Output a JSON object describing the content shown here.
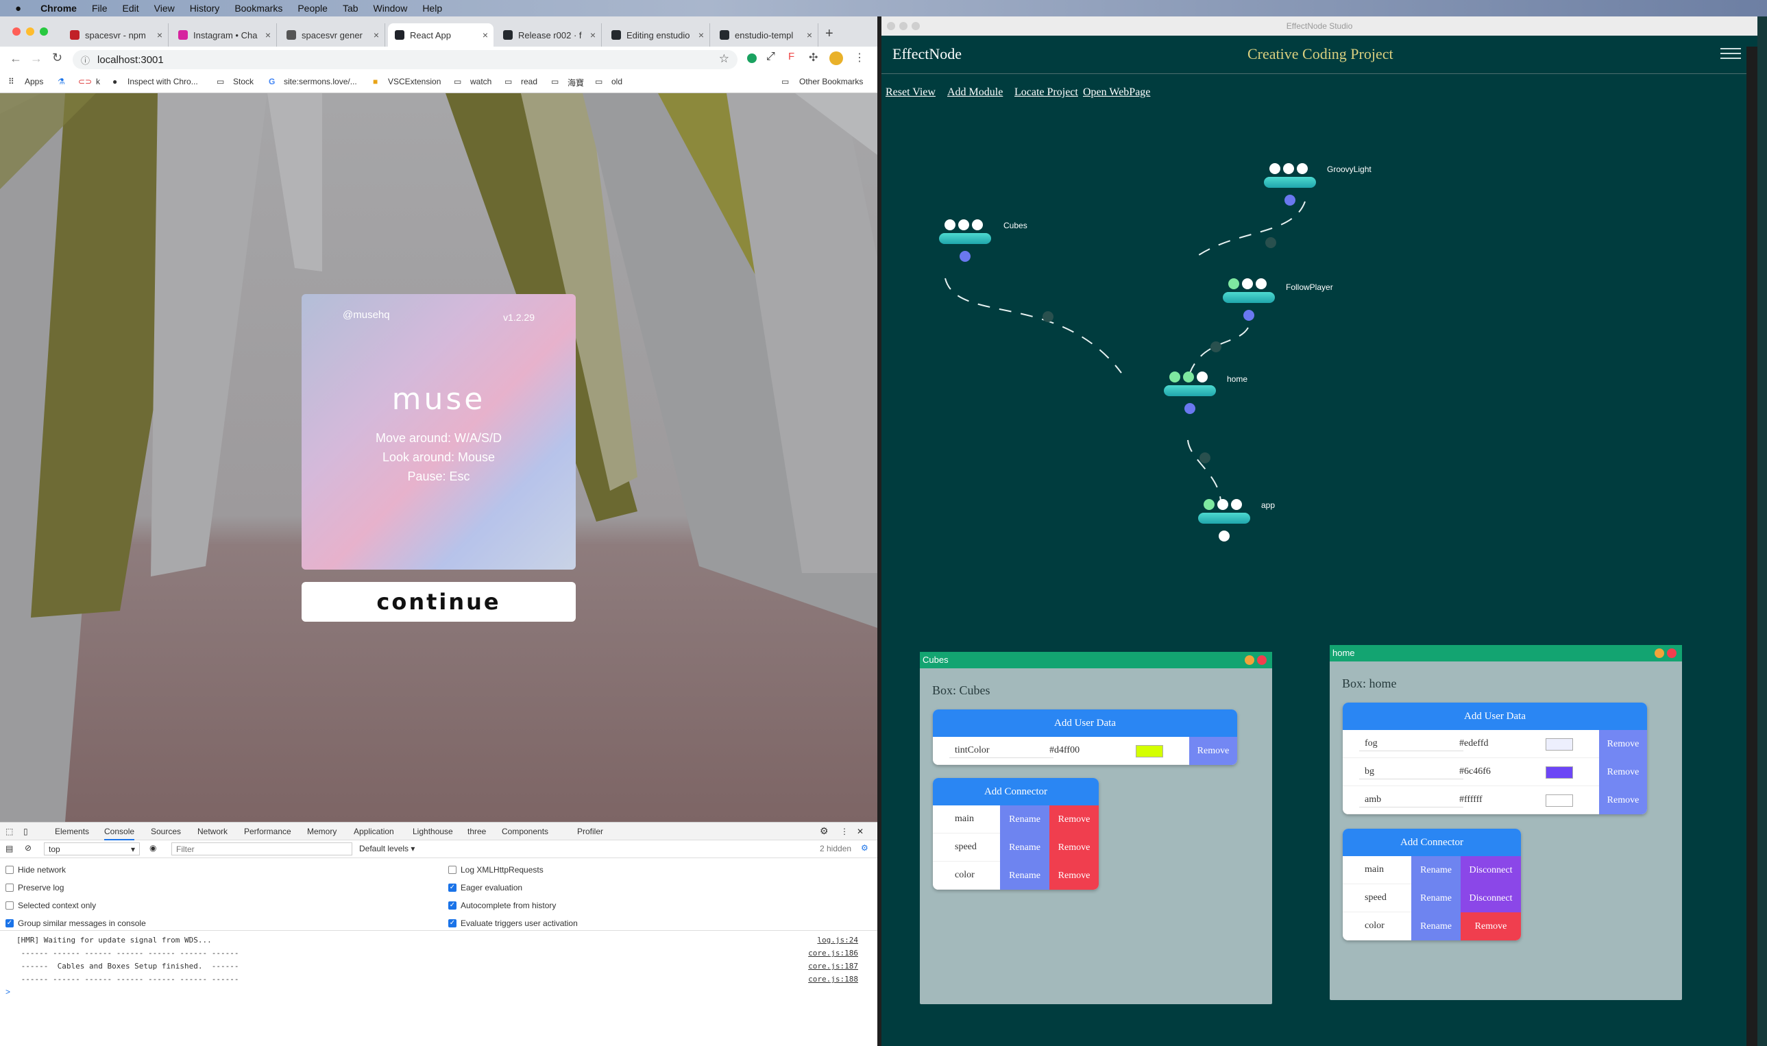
{
  "menubar": {
    "app": "Chrome",
    "items": [
      "File",
      "Edit",
      "View",
      "History",
      "Bookmarks",
      "People",
      "Tab",
      "Window",
      "Help"
    ]
  },
  "browser": {
    "tabs": [
      {
        "label": "spacesvr - npm",
        "color": "#c12127"
      },
      {
        "label": "Instagram • Cha",
        "color": "#d6249f"
      },
      {
        "label": "spacesvr gener",
        "color": "#555555"
      },
      {
        "label": "React App",
        "color": "#20232a"
      },
      {
        "label": "Release r002 · f",
        "color": "#24292e"
      },
      {
        "label": "Editing enstudio",
        "color": "#24292e"
      },
      {
        "label": "enstudio-templ",
        "color": "#24292e"
      }
    ],
    "new_tab": "+",
    "url": "localhost:3001",
    "bookmarks": [
      "Apps",
      "k",
      "Inspect with Chro...",
      "Stock",
      "site:sermons.love/...",
      "VSCExtension",
      "watch",
      "read",
      "海寶",
      "old",
      "Other Bookmarks"
    ]
  },
  "muse": {
    "handle": "@musehq",
    "version": "v1.2.29",
    "title": "muse",
    "line1": "Move around: W/A/S/D",
    "line2": "Look around: Mouse",
    "line3": "Pause: Esc",
    "continue": "continue"
  },
  "devtools": {
    "tabs": [
      "Elements",
      "Console",
      "Sources",
      "Network",
      "Performance",
      "Memory",
      "Application",
      "Lighthouse",
      "three",
      "Components",
      "Profiler"
    ],
    "context": "top",
    "filter_placeholder": "Filter",
    "levels": "Default levels ▾",
    "hidden": "2 hidden",
    "options_left": [
      {
        "label": "Hide network",
        "on": false
      },
      {
        "label": "Preserve log",
        "on": false
      },
      {
        "label": "Selected context only",
        "on": false
      },
      {
        "label": "Group similar messages in console",
        "on": true
      }
    ],
    "options_right": [
      {
        "label": "Log XMLHttpRequests",
        "on": false
      },
      {
        "label": "Eager evaluation",
        "on": true
      },
      {
        "label": "Autocomplete from history",
        "on": true
      },
      {
        "label": "Evaluate triggers user activation",
        "on": true
      }
    ],
    "logs": [
      {
        "text": "[HMR] Waiting for update signal from WDS...",
        "src": "log.js:24"
      },
      {
        "text": " ------ ------ ------ ------ ------ ------ ------",
        "src": "core.js:186"
      },
      {
        "text": " ------  Cables and Boxes Setup finished.  ------",
        "src": "core.js:187"
      },
      {
        "text": " ------ ------ ------ ------ ------ ------ ------",
        "src": "core.js:188"
      }
    ],
    "prompt": ">"
  },
  "studio": {
    "window_title": "EffectNode Studio",
    "brand": "EffectNode",
    "project": "Creative Coding Project",
    "nav": [
      "Reset View",
      "Add Module",
      "Locate Project",
      "Open WebPage"
    ],
    "nodes": {
      "cubes": "Cubes",
      "groovy": "GroovyLight",
      "follow": "FollowPlayer",
      "home": "home",
      "app": "app"
    },
    "cubes_panel": {
      "tab": "Cubes",
      "title": "Box: Cubes",
      "user_data_header": "Add User Data",
      "user_data": [
        {
          "key": "tintColor",
          "value": "#d4ff00",
          "swatch": "#d4ff00",
          "action": "Remove"
        }
      ],
      "connector_header": "Add Connector",
      "connectors": [
        {
          "name": "main",
          "rename": "Rename",
          "action": "Remove"
        },
        {
          "name": "speed",
          "rename": "Rename",
          "action": "Remove"
        },
        {
          "name": "color",
          "rename": "Rename",
          "action": "Remove"
        }
      ]
    },
    "home_panel": {
      "tab": "home",
      "title": "Box: home",
      "user_data_header": "Add User Data",
      "user_data": [
        {
          "key": "fog",
          "value": "#edeffd",
          "swatch": "#edeffd",
          "action": "Remove"
        },
        {
          "key": "bg",
          "value": "#6c46f6",
          "swatch": "#6c46f6",
          "action": "Remove"
        },
        {
          "key": "amb",
          "value": "#ffffff",
          "swatch": "#ffffff",
          "action": "Remove"
        }
      ],
      "connector_header": "Add Connector",
      "connectors": [
        {
          "name": "main",
          "rename": "Rename",
          "action": "Disconnect"
        },
        {
          "name": "speed",
          "rename": "Rename",
          "action": "Disconnect"
        },
        {
          "name": "color",
          "rename": "Rename",
          "action": "Remove"
        }
      ]
    }
  }
}
